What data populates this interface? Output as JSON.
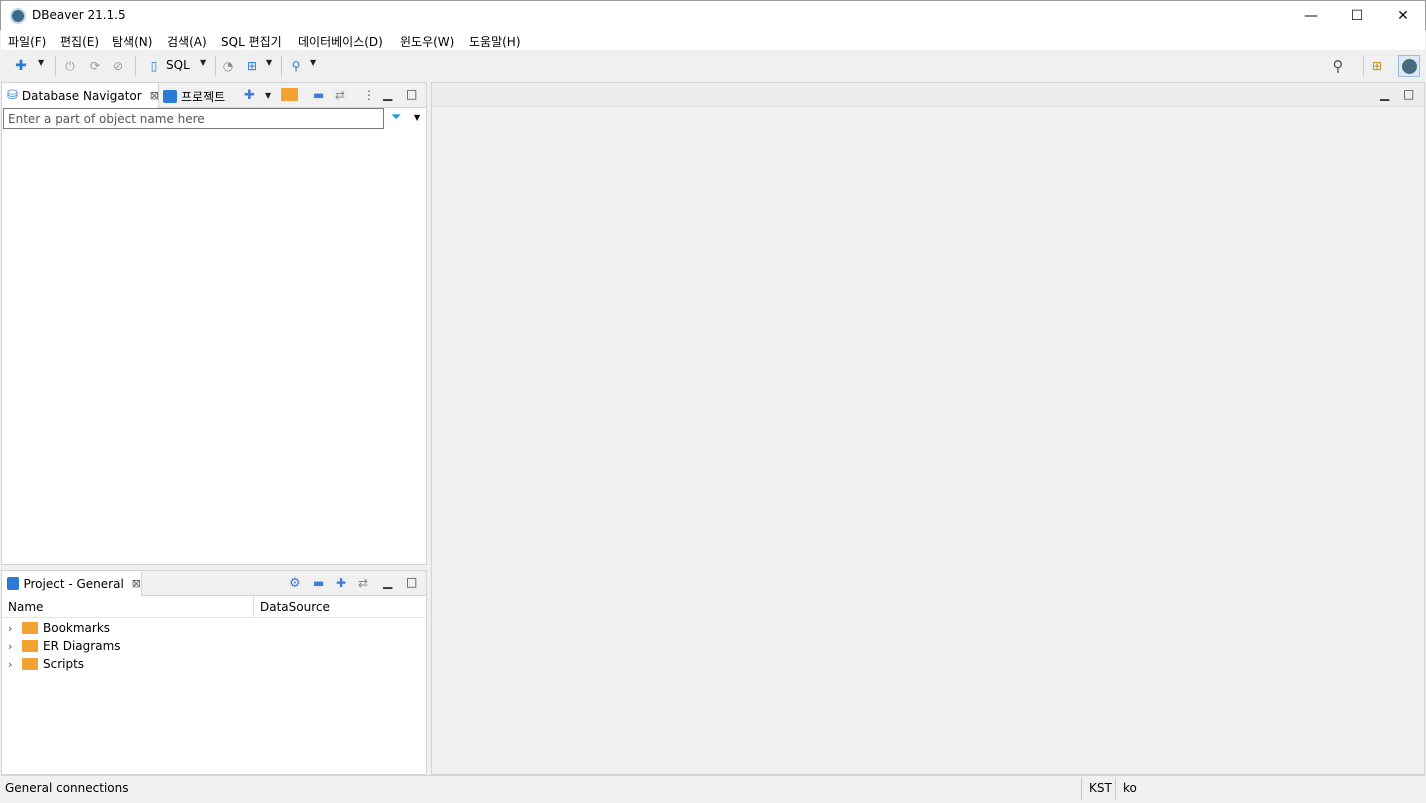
{
  "window": {
    "title": "DBeaver 21.1.5",
    "controls": {
      "minimize": "—",
      "maximize": "☐",
      "close": "✕"
    }
  },
  "menu": [
    "파일(F)",
    "편집(E)",
    "탐색(N)",
    "검색(A)",
    "SQL 편집기",
    "데이터베이스(D)",
    "윈도우(W)",
    "도움말(H)"
  ],
  "toolbar": {
    "sql_label": "SQL",
    "icons": [
      "new-connection-icon",
      "connect-icon",
      "reconnect-icon",
      "disconnect-icon",
      "sql-editor-icon",
      "dashboard-icon",
      "schema-compare-icon",
      "search-icon",
      "global-search-icon",
      "perspective-icon",
      "dbeaver-perspective-icon"
    ]
  },
  "navigator": {
    "tab_label": "Database Navigator",
    "tab2_label": "프로젝트",
    "search_placeholder": "Enter a part of object name here"
  },
  "project": {
    "tab_label": "Project - General",
    "columns": [
      "Name",
      "DataSource"
    ],
    "items": [
      {
        "label": "Bookmarks",
        "icon": "bookmarks-folder-icon"
      },
      {
        "label": "ER Diagrams",
        "icon": "er-diagrams-folder-icon"
      },
      {
        "label": "Scripts",
        "icon": "scripts-folder-icon"
      }
    ]
  },
  "status": {
    "left": "General connections",
    "timezone": "KST",
    "locale": "ko"
  },
  "colors": {
    "accent": "#2b7bd6",
    "folder": "#f2a233",
    "background": "#f0f0f0"
  }
}
